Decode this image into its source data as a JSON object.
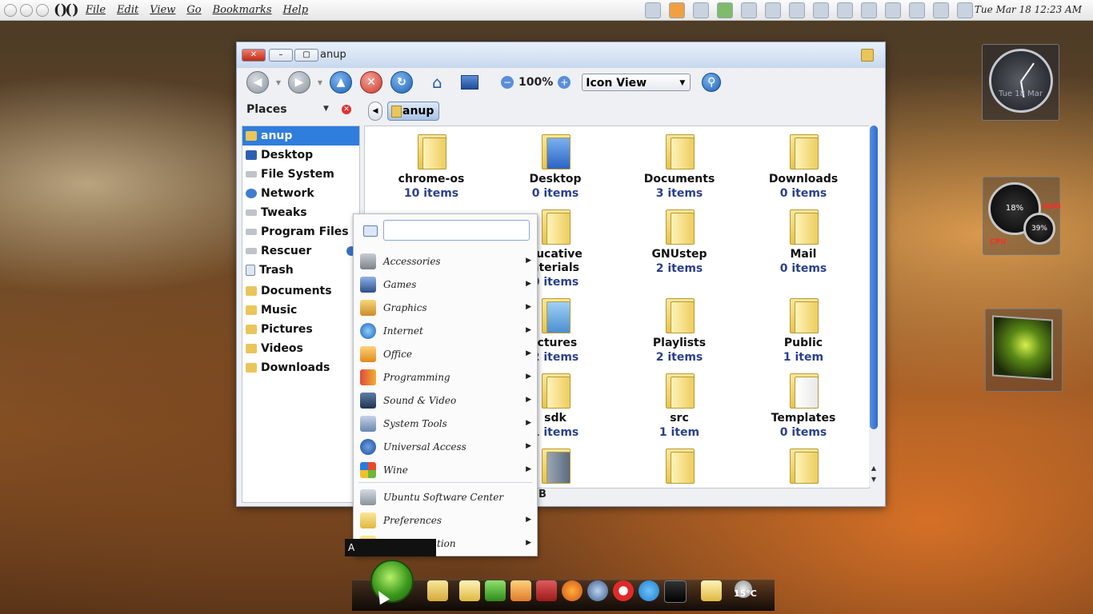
{
  "top_panel": {
    "menus": [
      "File",
      "Edit",
      "View",
      "Go",
      "Bookmarks",
      "Help"
    ],
    "clock": "Tue Mar 18 12:23 AM",
    "tray_icons": [
      "window-icon",
      "fish-icon",
      "cloud-icon",
      "monitor-icon",
      "network-icon",
      "pen-icon",
      "layers-icon",
      "printer-icon",
      "grid-icon",
      "panel-icon",
      "flag-icon",
      "clipboard-icon",
      "signal-icon",
      "volume-icon"
    ]
  },
  "window": {
    "title": "anup",
    "toolbar": {
      "zoom": "100%",
      "view_mode": "Icon View"
    },
    "places_header": "Places",
    "path_crumb": "anup",
    "sidebar": [
      {
        "label": "anup",
        "icon": "home-folder-icon",
        "selected": true
      },
      {
        "label": "Desktop",
        "icon": "desktop-icon"
      },
      {
        "label": "File System",
        "icon": "drive-icon"
      },
      {
        "label": "Network",
        "icon": "network-icon"
      },
      {
        "label": "Tweaks",
        "icon": "drive-icon"
      },
      {
        "label": "Program Files",
        "icon": "drive-icon"
      },
      {
        "label": "Rescuer",
        "icon": "drive-icon",
        "eject": true
      },
      {
        "label": "Trash",
        "icon": "trash-icon"
      },
      {
        "label": "Documents",
        "icon": "folder-icon"
      },
      {
        "label": "Music",
        "icon": "folder-icon"
      },
      {
        "label": "Pictures",
        "icon": "folder-icon"
      },
      {
        "label": "Videos",
        "icon": "folder-icon"
      },
      {
        "label": "Downloads",
        "icon": "folder-icon"
      }
    ],
    "files": [
      {
        "name": "chrome-os",
        "count": "10 items"
      },
      {
        "name": "Desktop",
        "count": "0 items"
      },
      {
        "name": "Documents",
        "count": "3 items"
      },
      {
        "name": "Downloads",
        "count": "0 items"
      },
      {
        "name": "",
        "count": ""
      },
      {
        "name": "ducative",
        "name2": "aterials",
        "count": "0 items"
      },
      {
        "name": "GNUstep",
        "count": "2 items"
      },
      {
        "name": "Mail",
        "count": "0 items"
      },
      {
        "name": "",
        "count": ""
      },
      {
        "name": "ictures",
        "count": "2 items"
      },
      {
        "name": "Playlists",
        "count": "2 items"
      },
      {
        "name": "Public",
        "count": "1 item"
      },
      {
        "name": "",
        "count": ""
      },
      {
        "name": "sdk",
        "count": "1 items"
      },
      {
        "name": "src",
        "count": "1 item"
      },
      {
        "name": "Templates",
        "count": "0 items"
      }
    ],
    "status_text": "B"
  },
  "app_menu": {
    "categories": [
      {
        "label": "Accessories",
        "icon": "accessories-icon",
        "submenu": true
      },
      {
        "label": "Games",
        "icon": "games-icon",
        "submenu": true
      },
      {
        "label": "Graphics",
        "icon": "graphics-icon",
        "submenu": true
      },
      {
        "label": "Internet",
        "icon": "internet-icon",
        "submenu": true
      },
      {
        "label": "Office",
        "icon": "office-icon",
        "submenu": true
      },
      {
        "label": "Programming",
        "icon": "programming-icon",
        "submenu": true
      },
      {
        "label": "Sound & Video",
        "icon": "sound-video-icon",
        "submenu": true
      },
      {
        "label": "System Tools",
        "icon": "system-tools-icon",
        "submenu": true
      },
      {
        "label": "Universal Access",
        "icon": "universal-access-icon",
        "submenu": true
      },
      {
        "label": "Wine",
        "icon": "wine-icon",
        "submenu": true
      }
    ],
    "system": [
      {
        "label": "Ubuntu Software Center",
        "icon": "software-center-icon",
        "submenu": false
      },
      {
        "label": "Preferences",
        "icon": "preferences-icon",
        "submenu": true
      },
      {
        "label": "Administration",
        "icon": "administration-icon",
        "submenu": true
      }
    ],
    "tooltip": "A"
  },
  "widgets": {
    "clock_date": "Tue 18 Mar",
    "cpu_value": "18%",
    "ram_value": "39%",
    "cpu_label": "CPU",
    "ram_label": "RAM"
  },
  "dock": {
    "temperature": "15°C",
    "icons": [
      "start-icon",
      "user-folder-icon",
      "files-icon",
      "settings-icon",
      "paint-icon",
      "dictionary-icon",
      "firefox-icon",
      "chrome-icon",
      "opera-icon",
      "skype-icon",
      "terminal-icon",
      "folder-view-icon",
      "weather-icon"
    ]
  },
  "colors": {
    "selection": "#2f7ddc",
    "item_count": "#2a3f8c",
    "title_bar": "#c7d8ee"
  }
}
